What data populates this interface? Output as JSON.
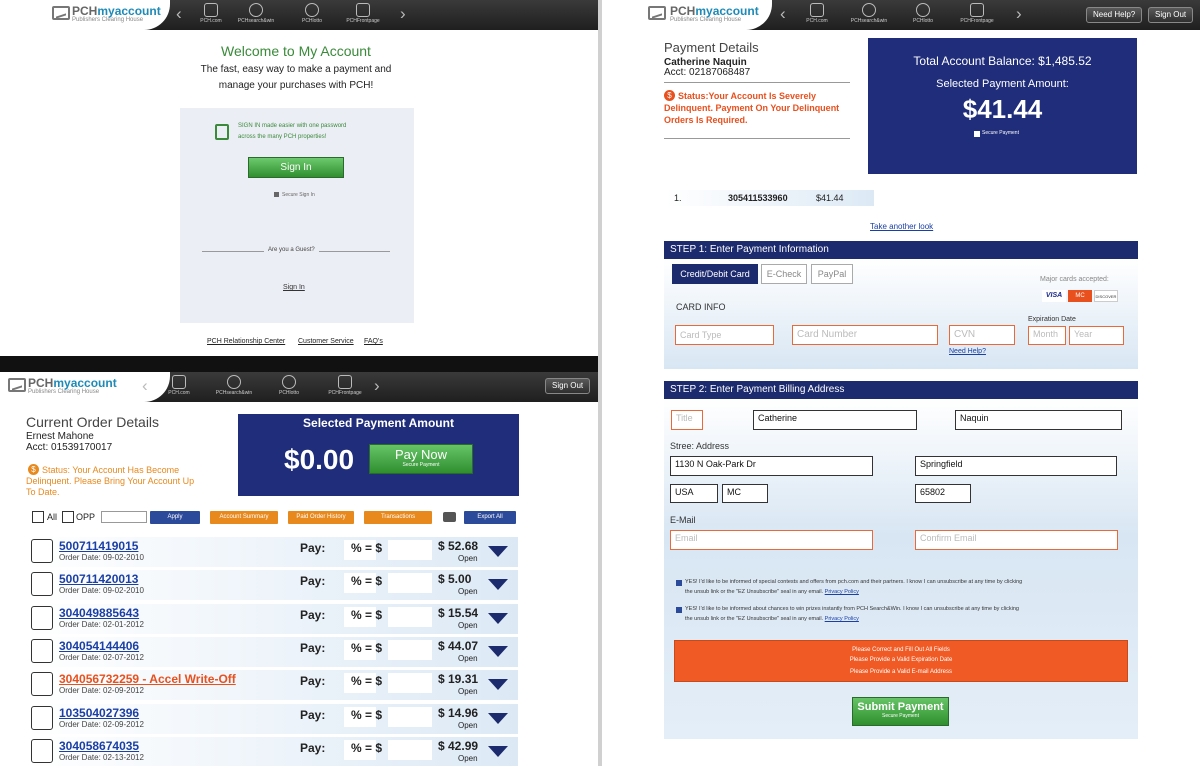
{
  "header": {
    "brand_main": "PCH",
    "brand_accent": "myaccount",
    "brand_sub": "Publishers Clearing House",
    "nav_items": [
      "PCH.com",
      "PCHsearch&win",
      "PCHlotto",
      "PCHFrontpage"
    ],
    "sign_out": "Sign Out",
    "need_help": "Need Help?"
  },
  "welcome": {
    "title": "Welcome to My Account",
    "subtitle1": "The fast, easy way to make a payment and",
    "subtitle2": "manage your purchases with PCH!",
    "sso1": "SIGN IN made easier with one password",
    "sso2": "across the many PCH properties!",
    "signin_button": "Sign In",
    "secure_signin": "Secure Sign In",
    "guest_q": "Are you a Guest?",
    "guest_link": "Sign In",
    "footer": {
      "relationship": "PCH Relationship Center",
      "service": "Customer Service",
      "faq": "FAQ's"
    }
  },
  "payment_details": {
    "title": "Payment Details",
    "name": "Catherine Naquin",
    "acct": "Acct: 02187068487",
    "status1": "Status:Your Account Is Severely",
    "status2": "Delinquent. Payment On Your Delinquent",
    "status3": "Orders Is Required.",
    "balance_label": "Total Account Balance: $1,485.52",
    "selected_label": "Selected Payment Amount:",
    "selected_amount": "$41.44",
    "secure_payment": "Secure Payment",
    "order_index": "1.",
    "order_number": "305411533960",
    "order_amount": "$41.44",
    "take_another": "Take another look"
  },
  "step1": {
    "title": "STEP 1: Enter Payment Information",
    "tabs": [
      "Credit/Debit Card",
      "E-Check",
      "PayPal"
    ],
    "major_cards": "Major cards accepted:",
    "card_brands": [
      "VISA",
      "MC",
      "DISCOVER"
    ],
    "card_info": "CARD INFO",
    "card_type_placeholder": "Card Type",
    "card_number_placeholder": "Card Number",
    "cvn_placeholder": "CVN",
    "exp_label": "Expiration Date",
    "month_placeholder": "Month",
    "year_placeholder": "Year",
    "need_help": "Need Help?"
  },
  "step2": {
    "title": "STEP 2: Enter Payment Billing Address",
    "title_placeholder": "Title",
    "first_name": "Catherine",
    "last_name": "Naquin",
    "street_label": "Stree: Address",
    "street": "1130 N Oak-Park Dr",
    "city": "Springfield",
    "country": "USA",
    "state": "MC",
    "zip": "65802",
    "email_label": "E-Mail",
    "email_placeholder": "Email",
    "confirm_email_placeholder": "Confirm Email",
    "optin1a": "YES! I'd like to be informed of special contests and offers from pch.com and their partners. I know I can unsubscribe at any time by clicking",
    "optin1b": "the unsub link or the \"EZ Unsubscribe\" seal in any email.",
    "optin2a": "YES! I'd like to be informed about chances to win prizes instantly from PCH Search&Win. I know I can unsubscribe at any time by clicking",
    "optin2b": "the unsub link or the \"EZ Unsubscribe\" seal in any email.",
    "privacy": "Privacy Policy",
    "errors": [
      "Please Correct and Fill Out All Fields",
      "Please Provide a Valid Expiration Date",
      "Please Provide a Valid E-mail Address"
    ],
    "submit": "Submit Payment",
    "submit_sub": "Secure Payment"
  },
  "orders": {
    "title": "Current Order Details",
    "name": "Ernest Mahone",
    "acct": "Acct: 01539170017",
    "status1": "Status: Your Account Has Become",
    "status2": "Delinquent. Please Bring Your Account Up",
    "status3": "To Date.",
    "selected_title": "Selected Payment Amount",
    "amount": "$0.00",
    "pay_now": "Pay Now",
    "pay_now_sub": "Secure Payment",
    "all_label": "All",
    "opp_label": "OPP",
    "apply": "Apply",
    "account_summary": "Account Summary",
    "paid_history": "Paid Order History",
    "transactions": "Transactions",
    "export": "Export All",
    "pay_label": "Pay:",
    "pct_label": "% = $",
    "rows": [
      {
        "number": "500711419015",
        "date": "Order Date: 09-02-2010",
        "amount": "$ 52.68",
        "status": "Open"
      },
      {
        "number": "500711420013",
        "date": "Order Date: 09-02-2010",
        "amount": "$  5.00",
        "status": "Open"
      },
      {
        "number": "304049885643",
        "date": "Order Date: 02-01-2012",
        "amount": "$ 15.54",
        "status": "Open"
      },
      {
        "number": "304054144406",
        "date": "Order Date: 02-07-2012",
        "amount": "$ 44.07",
        "status": "Open"
      },
      {
        "number": "304056732259 - Accel Write-Off",
        "date": "Order Date: 02-09-2012",
        "amount": "$ 19.31",
        "status": "Open"
      },
      {
        "number": "103504027396",
        "date": "Order Date: 02-09-2012",
        "amount": "$ 14.96",
        "status": "Open"
      },
      {
        "number": "304058674035",
        "date": "Order Date: 02-13-2012",
        "amount": "$ 42.99",
        "status": "Open"
      }
    ]
  }
}
